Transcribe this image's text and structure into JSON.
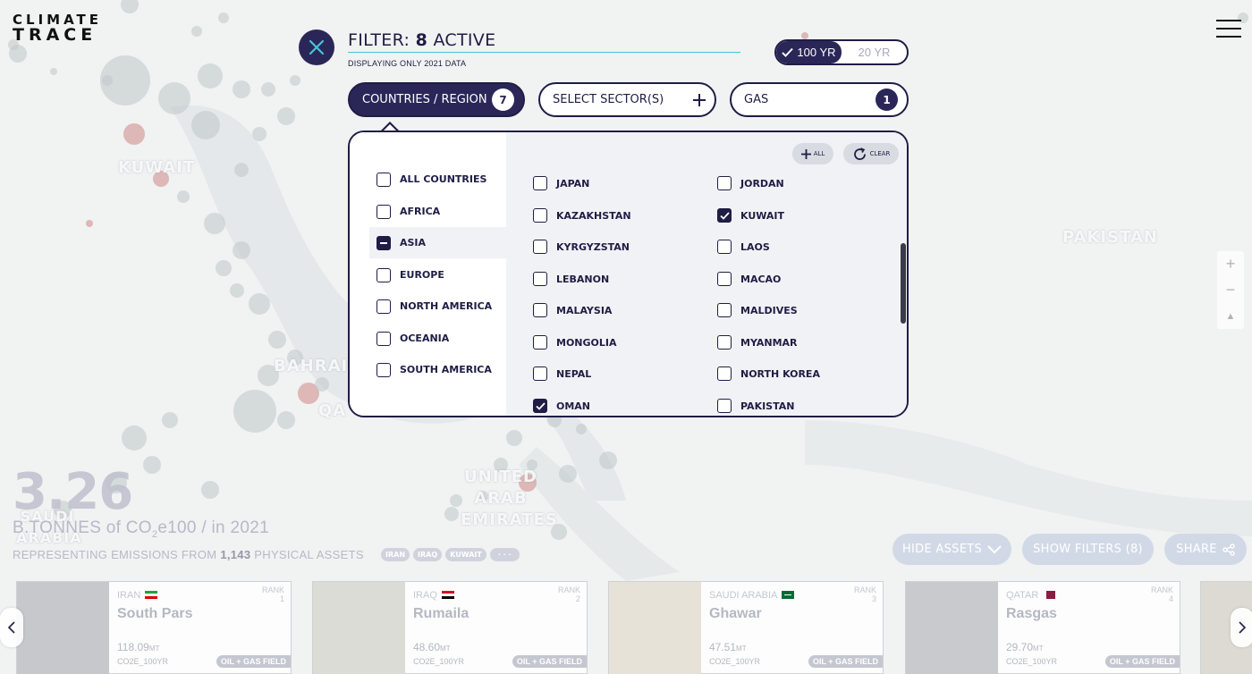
{
  "logo": {
    "line1": "CLIMATE",
    "line2": "TRACE"
  },
  "map": {
    "labels": [
      "KUWAIT",
      "BAHRAIN",
      "QA",
      "UNITED ARAB EMIRATES",
      "SAUDI ARABIA",
      "PAKISTAN"
    ]
  },
  "filter": {
    "title_prefix": "FILTER: ",
    "active_count": "8",
    "title_suffix": " ACTIVE",
    "subtitle": "DISPLAYING ONLY 2021 DATA",
    "year_toggle": {
      "active": "100 YR",
      "inactive": "20 YR"
    },
    "pills": {
      "countries": {
        "label": "COUNTRIES / REGION",
        "count": "7"
      },
      "sectors": {
        "label": "SELECT SECTOR(S)",
        "icon": "plus-icon"
      },
      "gas": {
        "label": "GAS",
        "count": "1"
      }
    }
  },
  "dropdown": {
    "all_label": "ALL",
    "clear_label": "CLEAR",
    "regions": [
      {
        "label": "ALL COUNTRIES",
        "state": "unchecked"
      },
      {
        "label": "AFRICA",
        "state": "unchecked"
      },
      {
        "label": "ASIA",
        "state": "partial"
      },
      {
        "label": "EUROPE",
        "state": "unchecked"
      },
      {
        "label": "NORTH AMERICA",
        "state": "unchecked"
      },
      {
        "label": "OCEANIA",
        "state": "unchecked"
      },
      {
        "label": "SOUTH AMERICA",
        "state": "unchecked"
      }
    ],
    "countries_col1": [
      {
        "label": "JAPAN",
        "checked": false
      },
      {
        "label": "KAZAKHSTAN",
        "checked": false
      },
      {
        "label": "KYRGYZSTAN",
        "checked": false
      },
      {
        "label": "LEBANON",
        "checked": false
      },
      {
        "label": "MALAYSIA",
        "checked": false
      },
      {
        "label": "MONGOLIA",
        "checked": false
      },
      {
        "label": "NEPAL",
        "checked": false
      },
      {
        "label": "OMAN",
        "checked": true
      }
    ],
    "countries_col2": [
      {
        "label": "JORDAN",
        "checked": false
      },
      {
        "label": "KUWAIT",
        "checked": true
      },
      {
        "label": "LAOS",
        "checked": false
      },
      {
        "label": "MACAO",
        "checked": false
      },
      {
        "label": "MALDIVES",
        "checked": false
      },
      {
        "label": "MYANMAR",
        "checked": false
      },
      {
        "label": "NORTH KOREA",
        "checked": false
      },
      {
        "label": "PAKISTAN",
        "checked": false
      }
    ]
  },
  "zoom": {
    "in": "+",
    "out": "−",
    "reset": "▲"
  },
  "stats": {
    "total": "3.26",
    "unit_prefix": "B.TONNES of CO",
    "unit_sub": "2",
    "unit_suffix": "e100 / in 2021",
    "rep_prefix": "REPRESENTING EMISSIONS FROM ",
    "rep_count": "1,143",
    "rep_suffix": " PHYSICAL ASSETS",
    "chips": [
      "IRAN",
      "IRAQ",
      "KUWAIT",
      "· · ·"
    ]
  },
  "actions": {
    "hide_assets": "HIDE ASSETS",
    "show_filters": "SHOW FILTERS (8)",
    "share": "SHARE"
  },
  "assets": [
    {
      "country": "IRAN",
      "rank": "1",
      "name": "South Pars",
      "value": "118.09",
      "value_unit": "MT",
      "gas": "CO2E_100YR",
      "type": "OIL + GAS FIELD",
      "thumb_color": "#c7c8cc",
      "flag": "iran"
    },
    {
      "country": "IRAQ",
      "rank": "2",
      "name": "Rumaila",
      "value": "48.60",
      "value_unit": "MT",
      "gas": "CO2E_100YR",
      "type": "OIL + GAS FIELD",
      "thumb_color": "#dcdcd6",
      "flag": "iraq"
    },
    {
      "country": "SAUDI ARABIA",
      "rank": "3",
      "name": "Ghawar",
      "value": "47.51",
      "value_unit": "MT",
      "gas": "CO2E_100YR",
      "type": "OIL + GAS FIELD",
      "thumb_color": "#e6e2d7",
      "flag": "saudi"
    },
    {
      "country": "QATAR",
      "rank": "4",
      "name": "Rasgas",
      "value": "29.70",
      "value_unit": "MT",
      "gas": "CO2E_100YR",
      "type": "OIL + GAS FIELD",
      "thumb_color": "#c9cacd",
      "flag": "qatar"
    }
  ],
  "rank_label": "RANK",
  "colors": {
    "navy": "#2a2758",
    "cyan": "#48c4d4",
    "map_bubble": "#c3cacc",
    "map_bubble_red": "#d7a3a3"
  }
}
